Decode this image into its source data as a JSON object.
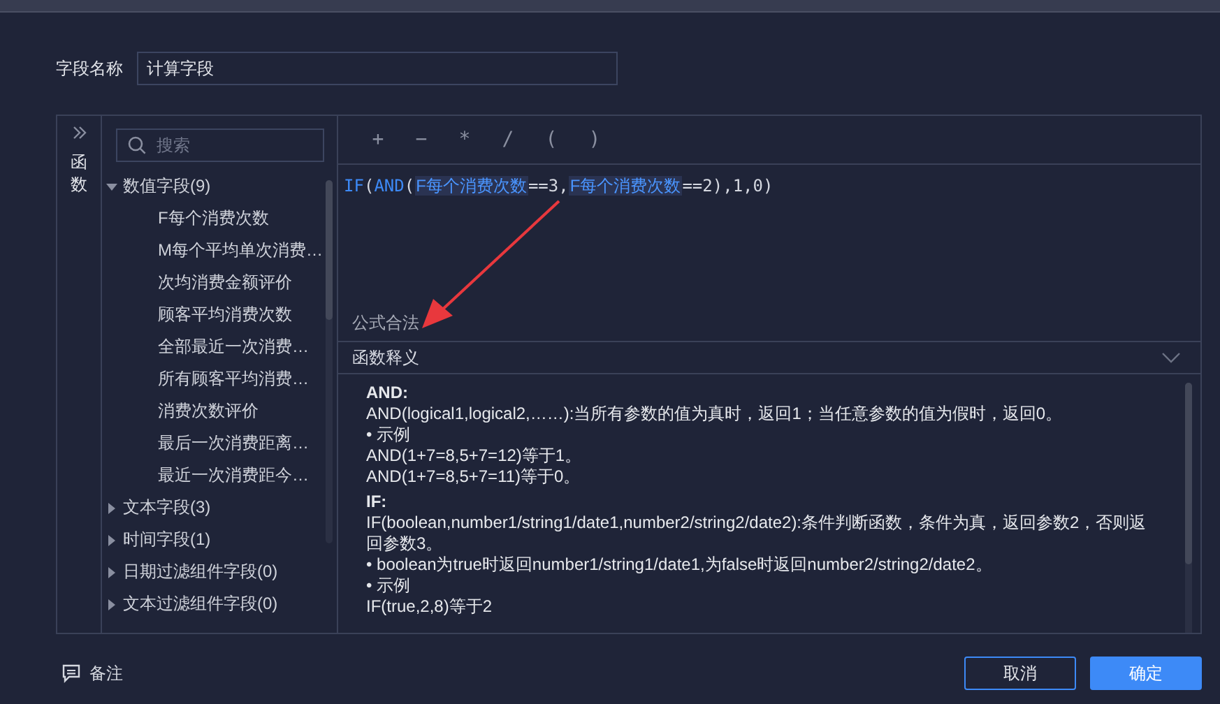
{
  "field_name": {
    "label": "字段名称",
    "value": "计算字段"
  },
  "side_tab": {
    "label": "函数"
  },
  "search": {
    "placeholder": "搜索"
  },
  "field_tree": [
    {
      "label": "数值字段(9)",
      "expanded": true,
      "children": [
        {
          "label": "F每个消费次数"
        },
        {
          "label": "M每个平均单次消费…"
        },
        {
          "label": "次均消费金额评价"
        },
        {
          "label": "顾客平均消费次数"
        },
        {
          "label": "全部最近一次消费…"
        },
        {
          "label": "所有顾客平均消费…"
        },
        {
          "label": "消费次数评价"
        },
        {
          "label": "最后一次消费距离…"
        },
        {
          "label": "最近一次消费距今…"
        }
      ]
    },
    {
      "label": "文本字段(3)",
      "expanded": false
    },
    {
      "label": "时间字段(1)",
      "expanded": false
    },
    {
      "label": "日期过滤组件字段(0)",
      "expanded": false
    },
    {
      "label": "文本过滤组件字段(0)",
      "expanded": false
    }
  ],
  "operators": [
    "+",
    "−",
    "*",
    "/",
    "(",
    ")"
  ],
  "formula": [
    {
      "kind": "func",
      "text": "IF"
    },
    {
      "kind": "plain",
      "text": "("
    },
    {
      "kind": "func",
      "text": "AND"
    },
    {
      "kind": "plain",
      "text": "("
    },
    {
      "kind": "field",
      "text": "F每个消费次数"
    },
    {
      "kind": "plain",
      "text": "==3,"
    },
    {
      "kind": "field",
      "text": "F每个消费次数"
    },
    {
      "kind": "plain",
      "text": "==2),1,0)"
    }
  ],
  "status": "公式合法",
  "help": {
    "title": "函数释义",
    "expanded": true,
    "lines": [
      {
        "kind": "heading",
        "text": "AND:"
      },
      {
        "kind": "text",
        "text": "AND(logical1,logical2,……):当所有参数的值为真时，返回1；当任意参数的值为假时，返回0。"
      },
      {
        "kind": "text",
        "text": "• 示例"
      },
      {
        "kind": "text",
        "text": "AND(1+7=8,5+7=12)等于1。"
      },
      {
        "kind": "text",
        "text": "AND(1+7=8,5+7=11)等于0。"
      },
      {
        "kind": "heading",
        "text": "IF:"
      },
      {
        "kind": "text",
        "text": "IF(boolean,number1/string1/date1,number2/string2/date2):条件判断函数，条件为真，返回参数2，否则返回参数3。"
      },
      {
        "kind": "text",
        "text": "• boolean为true时返回number1/string1/date1,为false时返回number2/string2/date2。"
      },
      {
        "kind": "text",
        "text": "• 示例"
      },
      {
        "kind": "text",
        "text": "IF(true,2,8)等于2"
      }
    ]
  },
  "note": {
    "label": "备注"
  },
  "buttons": [
    {
      "label": "取消",
      "kind": "secondary"
    },
    {
      "label": "确定",
      "kind": "primary"
    }
  ]
}
